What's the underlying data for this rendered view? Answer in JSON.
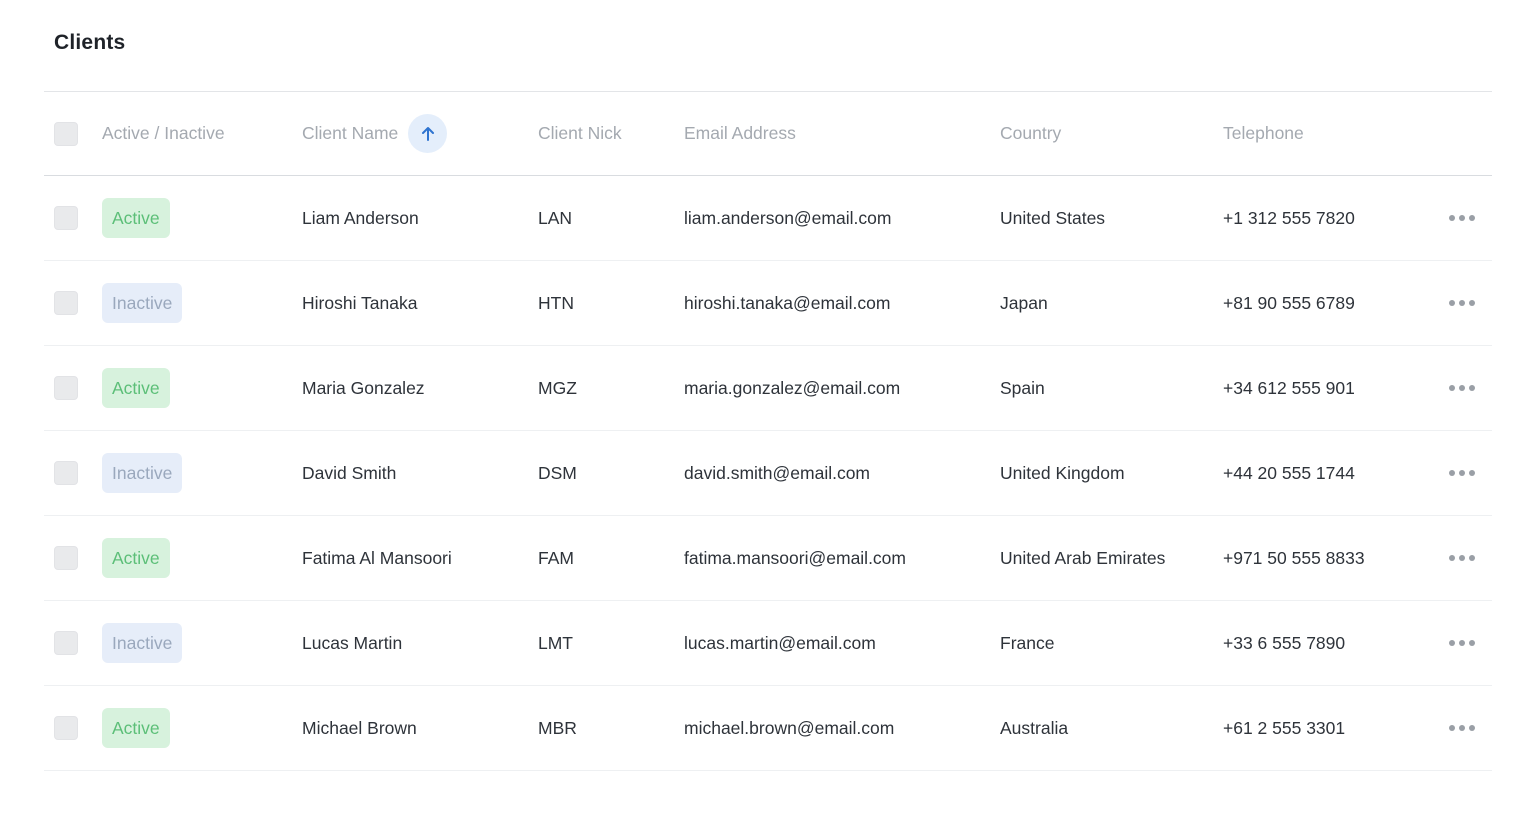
{
  "title": "Clients",
  "columns": {
    "status": "Active / Inactive",
    "name": "Client Name",
    "nick": "Client Nick",
    "email": "Email Address",
    "country": "Country",
    "phone": "Telephone"
  },
  "sort": {
    "column": "Client Name",
    "direction": "ascending",
    "icon": "arrow-up-icon"
  },
  "colors": {
    "active_bg": "#d7f2dd",
    "active_text": "#5cbf78",
    "inactive_bg": "#e6edf9",
    "inactive_text": "#9aa8bd",
    "sort_accent": "#2f74d0"
  },
  "rows": [
    {
      "status": "Active",
      "name": "Liam Anderson",
      "nick": "LAN",
      "email": "liam.anderson@email.com",
      "country": "United States",
      "phone": "+1 312 555 7820"
    },
    {
      "status": "Inactive",
      "name": "Hiroshi Tanaka",
      "nick": "HTN",
      "email": "hiroshi.tanaka@email.com",
      "country": "Japan",
      "phone": "+81 90 555 6789"
    },
    {
      "status": "Active",
      "name": "Maria Gonzalez",
      "nick": "MGZ",
      "email": "maria.gonzalez@email.com",
      "country": "Spain",
      "phone": "+34 612 555 901"
    },
    {
      "status": "Inactive",
      "name": "David Smith",
      "nick": "DSM",
      "email": "david.smith@email.com",
      "country": "United Kingdom",
      "phone": "+44 20 555 1744"
    },
    {
      "status": "Active",
      "name": "Fatima Al Mansoori",
      "nick": "FAM",
      "email": "fatima.mansoori@email.com",
      "country": "United Arab Emirates",
      "phone": "+971 50 555 8833"
    },
    {
      "status": "Inactive",
      "name": "Lucas Martin",
      "nick": "LMT",
      "email": "lucas.martin@email.com",
      "country": "France",
      "phone": "+33 6 555 7890"
    },
    {
      "status": "Active",
      "name": "Michael Brown",
      "nick": "MBR",
      "email": "michael.brown@email.com",
      "country": "Australia",
      "phone": "+61 2 555 3301"
    }
  ]
}
